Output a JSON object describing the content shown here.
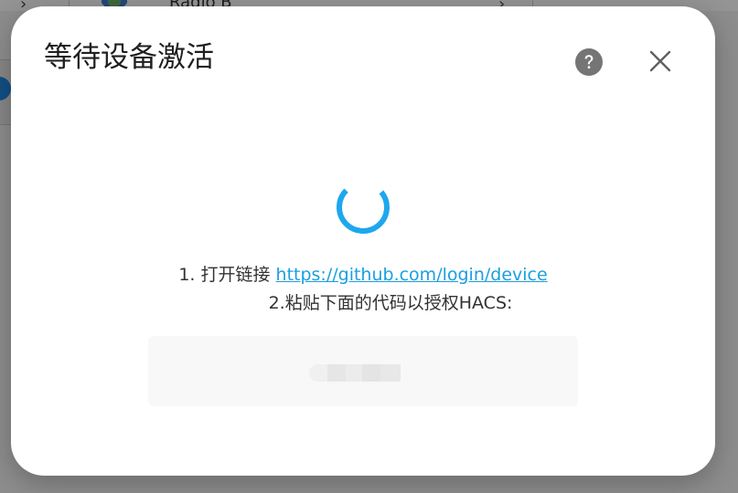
{
  "background": {
    "card_title": "Radio B"
  },
  "dialog": {
    "title": "等待设备激活",
    "help_icon": "help-circle-icon",
    "close_icon": "close-icon",
    "instruction_1": {
      "prefix": "1. 打开链接 ",
      "link_text": "https://github.com/login/device"
    },
    "instruction_2": "2.粘贴下面的代码以授权HACS:",
    "colors": {
      "spinner": "#1ea7ef",
      "link": "#1a9fe0",
      "help_icon": "#757575"
    }
  }
}
